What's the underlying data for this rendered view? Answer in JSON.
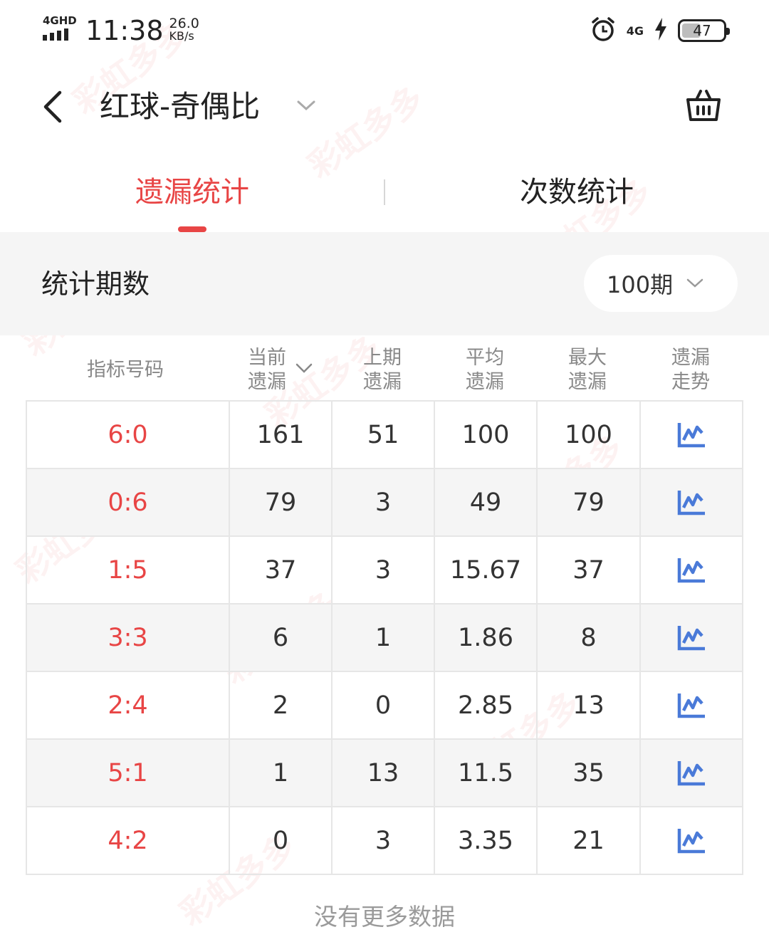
{
  "status_bar": {
    "network_label": "4GHD",
    "time": "11:38",
    "speed_value": "26.0",
    "speed_unit": "KB/s",
    "net_type": "4G",
    "battery": "47",
    "battery_level": 0.47
  },
  "header": {
    "title": "红球-奇偶比"
  },
  "tabs": [
    {
      "label": "遗漏统计",
      "active": true
    },
    {
      "label": "次数统计",
      "active": false
    }
  ],
  "period": {
    "label": "统计期数",
    "selected": "100期"
  },
  "table": {
    "headers": [
      {
        "line1": "指标号码",
        "line2": ""
      },
      {
        "line1": "当前",
        "line2": "遗漏"
      },
      {
        "line1": "上期",
        "line2": "遗漏"
      },
      {
        "line1": "平均",
        "line2": "遗漏"
      },
      {
        "line1": "最大",
        "line2": "遗漏"
      },
      {
        "line1": "遗漏",
        "line2": "走势"
      }
    ],
    "rows": [
      {
        "code": "6:0",
        "current": "161",
        "last": "51",
        "avg": "100",
        "max": "100"
      },
      {
        "code": "0:6",
        "current": "79",
        "last": "3",
        "avg": "49",
        "max": "79"
      },
      {
        "code": "1:5",
        "current": "37",
        "last": "3",
        "avg": "15.67",
        "max": "37"
      },
      {
        "code": "3:3",
        "current": "6",
        "last": "1",
        "avg": "1.86",
        "max": "8"
      },
      {
        "code": "2:4",
        "current": "2",
        "last": "0",
        "avg": "2.85",
        "max": "13"
      },
      {
        "code": "5:1",
        "current": "1",
        "last": "13",
        "avg": "11.5",
        "max": "35"
      },
      {
        "code": "4:2",
        "current": "0",
        "last": "3",
        "avg": "3.35",
        "max": "21"
      }
    ]
  },
  "footer": {
    "no_more": "没有更多数据"
  },
  "watermark": "彩虹多多",
  "colors": {
    "accent": "#e84545",
    "trend_icon": "#4a7ad8",
    "gray_bg": "#f5f5f5"
  }
}
